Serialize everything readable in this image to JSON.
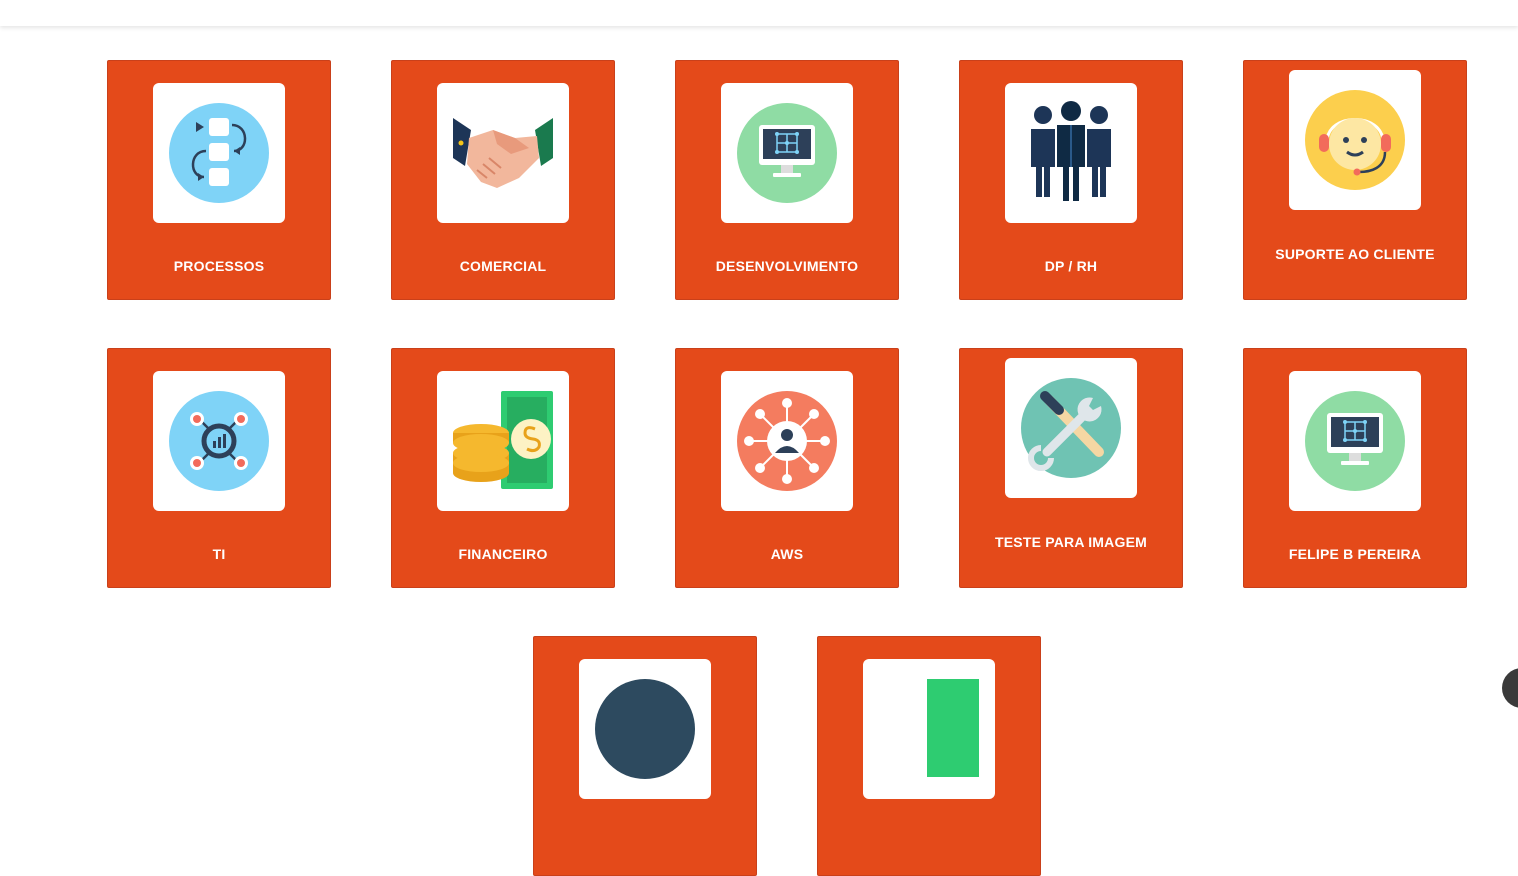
{
  "cards": [
    {
      "label": "PROCESSOS",
      "icon": "process-flow-icon"
    },
    {
      "label": "COMERCIAL",
      "icon": "handshake-icon"
    },
    {
      "label": "DESENVOLVIMENTO",
      "icon": "monitor-network-icon"
    },
    {
      "label": "DP / RH",
      "icon": "people-group-icon"
    },
    {
      "label": "SUPORTE AO CLIENTE",
      "icon": "support-headset-icon"
    },
    {
      "label": "TI",
      "icon": "tech-hub-icon"
    },
    {
      "label": "FINANCEIRO",
      "icon": "coins-money-icon"
    },
    {
      "label": "AWS",
      "icon": "user-network-icon"
    },
    {
      "label": "TESTE PARA IMAGEM",
      "icon": "tools-icon"
    },
    {
      "label": "FELIPE B PEREIRA",
      "icon": "monitor-network-icon"
    }
  ],
  "colors": {
    "card_background": "#e44a1a",
    "tile_background": "#ffffff",
    "label_text": "#ffffff"
  }
}
